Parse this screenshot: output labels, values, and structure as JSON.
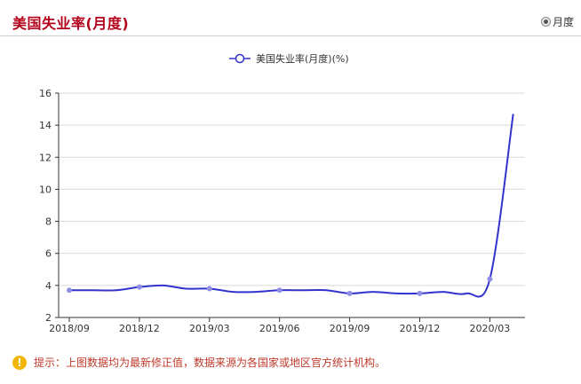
{
  "header": {
    "title": "美国失业率(月度)",
    "period_option": "月度",
    "period_selected": true
  },
  "footer": {
    "icon": "warning-icon",
    "note": "提示：上图数据均为最新修正值，数据来源为各国家或地区官方统计机构。"
  },
  "colors": {
    "title": "#b3001b",
    "line": "#3333cc",
    "marker": "#8f8fe6",
    "grid": "#d9d9d9",
    "note": "#c0392b",
    "warning": "#f2b705"
  },
  "chart_data": {
    "type": "line",
    "legend_position": "top-center",
    "grid": true,
    "ylim": [
      2,
      16
    ],
    "yticks": [
      2,
      4,
      6,
      8,
      10,
      12,
      14,
      16
    ],
    "xtick_labels": [
      "2018/09",
      "2018/12",
      "2019/03",
      "2019/06",
      "2019/09",
      "2019/12",
      "2020/03"
    ],
    "x": [
      "2018/09",
      "2018/10",
      "2018/11",
      "2018/12",
      "2019/01",
      "2019/02",
      "2019/03",
      "2019/04",
      "2019/05",
      "2019/06",
      "2019/07",
      "2019/08",
      "2019/09",
      "2019/10",
      "2019/11",
      "2019/12",
      "2020/01",
      "2020/02",
      "2020/03",
      "2020/04"
    ],
    "series": [
      {
        "name": "美国失业率(月度)(%)",
        "values": [
          3.7,
          3.7,
          3.7,
          3.9,
          4.0,
          3.8,
          3.8,
          3.6,
          3.6,
          3.7,
          3.7,
          3.7,
          3.5,
          3.6,
          3.5,
          3.5,
          3.6,
          3.5,
          4.4,
          14.7
        ]
      }
    ]
  }
}
